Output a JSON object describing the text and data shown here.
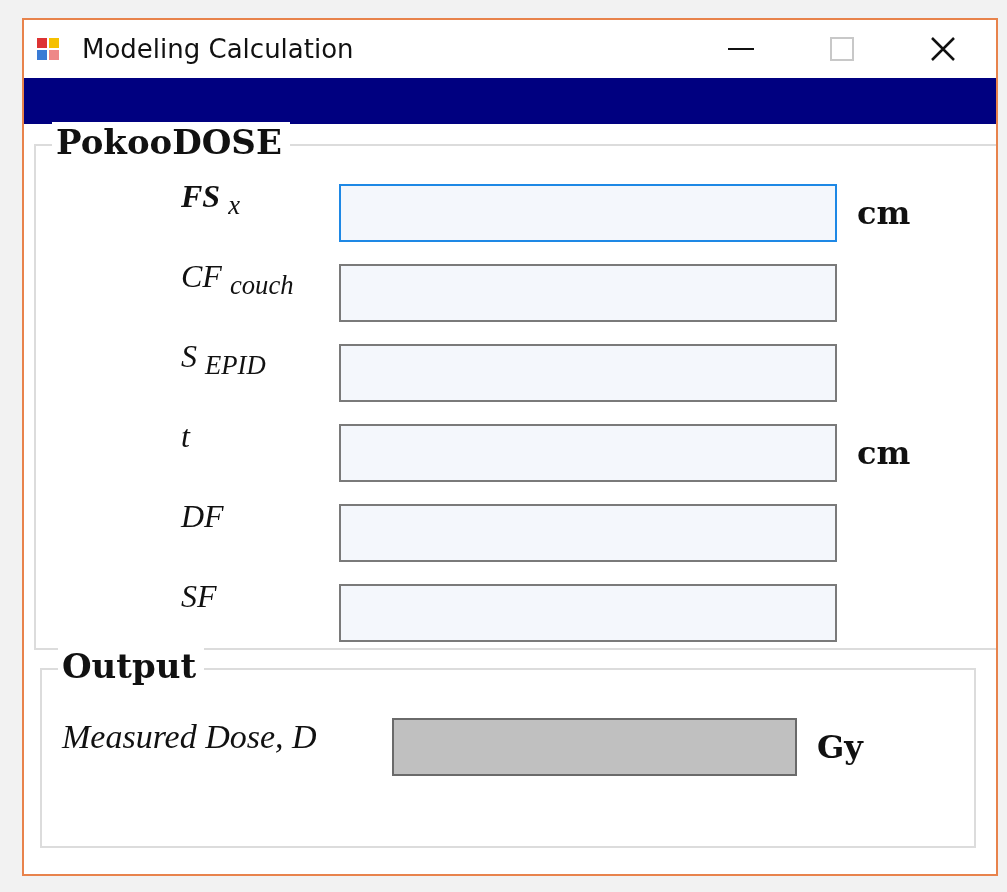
{
  "window": {
    "title": "Modeling Calculation"
  },
  "input_group": {
    "title": "PokooDOSE",
    "fields": [
      {
        "label": "**FS** $_{x}$",
        "unit": "cm",
        "focused": true
      },
      {
        "label": "CF $_{couch}$",
        "focused": false
      },
      {
        "label": "S $_{EPID}$",
        "focused": false
      },
      {
        "label": "t",
        "unit": "cm",
        "focused": false
      },
      {
        "label": "DF",
        "focused": false
      },
      {
        "label": "SF",
        "focused": false
      }
    ]
  },
  "output_group": {
    "title": "Output",
    "label": "Measured Dose, D",
    "unit": "Gy"
  }
}
